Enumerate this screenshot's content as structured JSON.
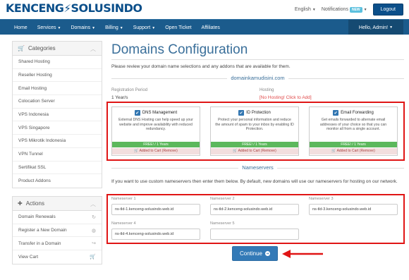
{
  "header": {
    "logo_left": "KENCENG",
    "logo_right": "SOLUSINDO",
    "language": "English",
    "notifications": "Notifications",
    "notifications_badge": "NEW",
    "logout": "Logout"
  },
  "nav": {
    "items": [
      {
        "label": "Home",
        "dropdown": false
      },
      {
        "label": "Services",
        "dropdown": true
      },
      {
        "label": "Domains",
        "dropdown": true
      },
      {
        "label": "Billing",
        "dropdown": true
      },
      {
        "label": "Support",
        "dropdown": true
      },
      {
        "label": "Open Ticket",
        "dropdown": false
      },
      {
        "label": "Affiliates",
        "dropdown": false
      }
    ],
    "user": "Hello, Admin!"
  },
  "sidebar": {
    "categories_title": "Categories",
    "categories": [
      "Shared Hosting",
      "Reseller Hosting",
      "Email Hosting",
      "Colocation Server",
      "VPS Indonesia",
      "VPS Singapore",
      "VPS Mikrotik Indonesia",
      "VPN Tunnel",
      "Sertifikat SSL",
      "Product Addons"
    ],
    "actions_title": "Actions",
    "actions": [
      {
        "label": "Domain Renewals",
        "icon": "refresh-icon"
      },
      {
        "label": "Register a New Domain",
        "icon": "globe-icon"
      },
      {
        "label": "Transfer in a Domain",
        "icon": "share-icon"
      },
      {
        "label": "View Cart",
        "icon": "cart-icon"
      }
    ]
  },
  "main": {
    "title": "Domains Configuration",
    "intro": "Please review your domain name selections and any addons that are available for them.",
    "domain": "domainkamudisini.com",
    "registration_period_label": "Registration Period",
    "registration_period_value": "1 Year/s",
    "hosting_label": "Hosting",
    "hosting_value": "[No Hosting! Click to Add]",
    "addons": [
      {
        "name": "DNS Management",
        "description": "External DNS Hosting can help speed up your website and improve availability with reduced redundancy.",
        "price": "FREE! / 1 Years",
        "added": "Added to Cart (Remove)"
      },
      {
        "name": "ID Protection",
        "description": "Protect your personal information and reduce the amount of spam to your inbox by enabling ID Protection.",
        "price": "FREE! / 1 Years",
        "added": "Added to Cart (Remove)"
      },
      {
        "name": "Email Forwarding",
        "description": "Get emails forwarded to alternate email addresses of your choice so that you can monitor all from a single account.",
        "price": "FREE! / 1 Years",
        "added": "Added to Cart (Remove)"
      }
    ],
    "nameservers_title": "Nameservers",
    "nameservers_desc": "If you want to use custom nameservers then enter them below. By default, new domains will use our nameservers for hosting on our network.",
    "nameservers": [
      {
        "label": "Nameserver 1",
        "value": "ns-tld-1.kenceng-solusindo.web.id"
      },
      {
        "label": "Nameserver 2",
        "value": "ns-tld-2.kenceng-solusindo.web.id"
      },
      {
        "label": "Nameserver 3",
        "value": "ns-tld-3.kenceng-solusindo.web.id"
      },
      {
        "label": "Nameserver 4",
        "value": "ns-tld-4.kenceng-solusindo.web.id"
      },
      {
        "label": "Nameserver 5",
        "value": ""
      }
    ],
    "continue": "Continue"
  },
  "colors": {
    "brand": "#0b4f8a",
    "navbar": "#1b5b8c",
    "title": "#3a6f9a",
    "highlight": "#e01515",
    "success": "#5cb85c",
    "primary_button": "#337ab7"
  }
}
